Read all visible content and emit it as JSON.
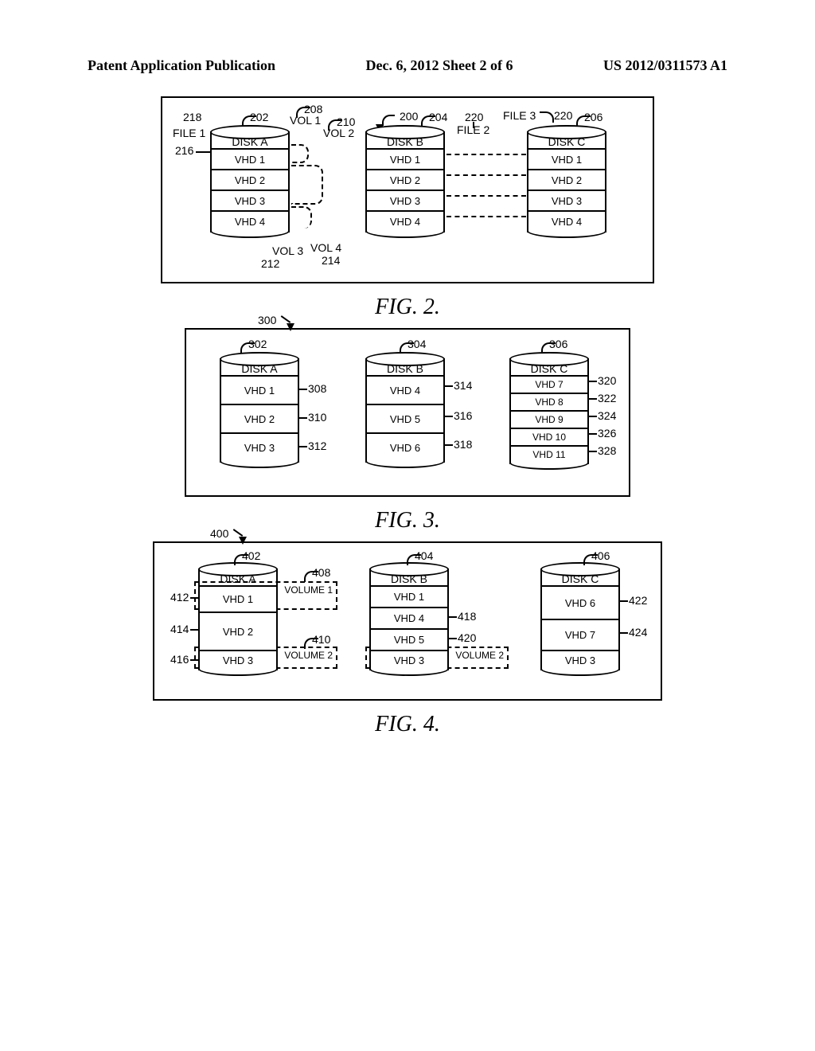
{
  "header": {
    "left": "Patent Application Publication",
    "center": "Dec. 6, 2012  Sheet 2 of 6",
    "right": "US 2012/0311573 A1"
  },
  "figures": {
    "fig2": {
      "caption": "FIG. 2.",
      "box_ref": "200",
      "disks": [
        {
          "title": "DISK A",
          "ref": "202",
          "rows": [
            "VHD 1",
            "VHD 2",
            "VHD 3",
            "VHD 4"
          ]
        },
        {
          "title": "DISK B",
          "ref": "204",
          "rows": [
            "VHD 1",
            "VHD 2",
            "VHD 3",
            "VHD 4"
          ]
        },
        {
          "title": "DISK C",
          "ref": "206",
          "rows": [
            "VHD 1",
            "VHD 2",
            "VHD 3",
            "VHD 4"
          ]
        }
      ],
      "files": {
        "file1_ref": "218",
        "file1": "FILE 1",
        "file2_ref": "220",
        "file2": "FILE 2",
        "file3": "FILE 3",
        "file3_ref": "220"
      },
      "vhd1_ref": "216",
      "vols": {
        "v1_ref": "208",
        "v1": "VOL 1",
        "v2_ref": "210",
        "v2": "VOL 2",
        "v3_ref": "212",
        "v3": "VOL 3",
        "v4_ref": "214",
        "v4": "VOL 4"
      }
    },
    "fig3": {
      "caption": "FIG. 3.",
      "box_ref": "300",
      "disks": [
        {
          "title": "DISK A",
          "ref": "302",
          "rows": [
            {
              "label": "VHD 1",
              "ref": "308"
            },
            {
              "label": "VHD 2",
              "ref": "310"
            },
            {
              "label": "VHD 3",
              "ref": "312"
            }
          ]
        },
        {
          "title": "DISK B",
          "ref": "304",
          "rows": [
            {
              "label": "VHD 4",
              "ref": "314"
            },
            {
              "label": "VHD 5",
              "ref": "316"
            },
            {
              "label": "VHD 6",
              "ref": "318"
            }
          ]
        },
        {
          "title": "DISK C",
          "ref": "306",
          "rows": [
            {
              "label": "VHD 7",
              "ref": "320"
            },
            {
              "label": "VHD 8",
              "ref": "322"
            },
            {
              "label": "VHD 9",
              "ref": "324"
            },
            {
              "label": "VHD 10",
              "ref": "326"
            },
            {
              "label": "VHD 11",
              "ref": "328"
            }
          ]
        }
      ]
    },
    "fig4": {
      "caption": "FIG. 4.",
      "box_ref": "400",
      "disks": [
        {
          "title": "DISK A",
          "ref": "402",
          "rows": [
            {
              "label": "VHD 1",
              "ref": "412"
            },
            {
              "label": "VHD 2",
              "ref": "414"
            },
            {
              "label": "VHD 3",
              "ref": "416"
            }
          ]
        },
        {
          "title": "DISK B",
          "ref": "404",
          "rows": [
            {
              "label": "VHD 1",
              "ref": null
            },
            {
              "label": "VHD 4",
              "ref": "418"
            },
            {
              "label": "VHD 5",
              "ref": "420"
            },
            {
              "label": "VHD 3",
              "ref": null
            }
          ]
        },
        {
          "title": "DISK C",
          "ref": "406",
          "rows": [
            {
              "label": "VHD 6",
              "ref": "422"
            },
            {
              "label": "VHD 7",
              "ref": "424"
            },
            {
              "label": "VHD 3",
              "ref": null
            }
          ]
        }
      ],
      "vols": {
        "v1_ref": "408",
        "v1": "VOLUME 1",
        "v2_ref": "410",
        "v2": "VOLUME 2",
        "v2b": "VOLUME 2"
      }
    }
  }
}
